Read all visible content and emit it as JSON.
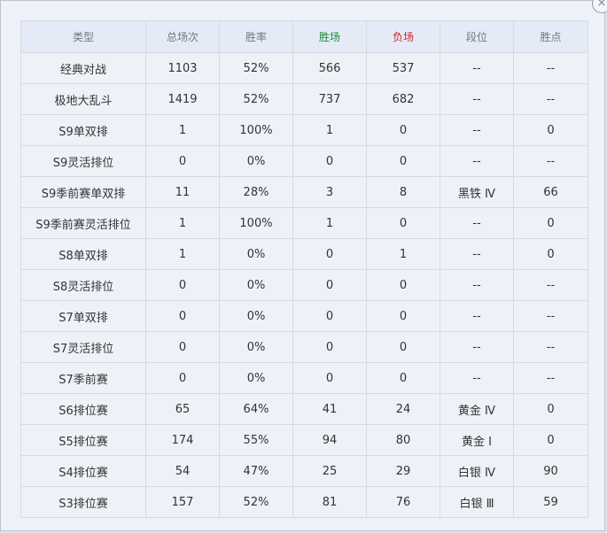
{
  "headers": {
    "type": "类型",
    "total": "总场次",
    "rate": "胜率",
    "wins": "胜场",
    "losses": "负场",
    "rank": "段位",
    "points": "胜点"
  },
  "colors": {
    "wins_header": "#1d8a3c",
    "losses_header": "#d32424"
  },
  "close_icon": "×",
  "rows": [
    {
      "type": "经典对战",
      "total": "1103",
      "rate": "52%",
      "wins": "566",
      "losses": "537",
      "rank": "--",
      "points": "--"
    },
    {
      "type": "极地大乱斗",
      "total": "1419",
      "rate": "52%",
      "wins": "737",
      "losses": "682",
      "rank": "--",
      "points": "--"
    },
    {
      "type": "S9单双排",
      "total": "1",
      "rate": "100%",
      "wins": "1",
      "losses": "0",
      "rank": "--",
      "points": "0"
    },
    {
      "type": "S9灵活排位",
      "total": "0",
      "rate": "0%",
      "wins": "0",
      "losses": "0",
      "rank": "--",
      "points": "--"
    },
    {
      "type": "S9季前赛单双排",
      "total": "11",
      "rate": "28%",
      "wins": "3",
      "losses": "8",
      "rank": "黑铁 Ⅳ",
      "points": "66"
    },
    {
      "type": "S9季前赛灵活排位",
      "total": "1",
      "rate": "100%",
      "wins": "1",
      "losses": "0",
      "rank": "--",
      "points": "0"
    },
    {
      "type": "S8单双排",
      "total": "1",
      "rate": "0%",
      "wins": "0",
      "losses": "1",
      "rank": "--",
      "points": "0"
    },
    {
      "type": "S8灵活排位",
      "total": "0",
      "rate": "0%",
      "wins": "0",
      "losses": "0",
      "rank": "--",
      "points": "--"
    },
    {
      "type": "S7单双排",
      "total": "0",
      "rate": "0%",
      "wins": "0",
      "losses": "0",
      "rank": "--",
      "points": "--"
    },
    {
      "type": "S7灵活排位",
      "total": "0",
      "rate": "0%",
      "wins": "0",
      "losses": "0",
      "rank": "--",
      "points": "--"
    },
    {
      "type": "S7季前赛",
      "total": "0",
      "rate": "0%",
      "wins": "0",
      "losses": "0",
      "rank": "--",
      "points": "--"
    },
    {
      "type": "S6排位赛",
      "total": "65",
      "rate": "64%",
      "wins": "41",
      "losses": "24",
      "rank": "黄金 Ⅳ",
      "points": "0"
    },
    {
      "type": "S5排位赛",
      "total": "174",
      "rate": "55%",
      "wins": "94",
      "losses": "80",
      "rank": "黄金 Ⅰ",
      "points": "0"
    },
    {
      "type": "S4排位赛",
      "total": "54",
      "rate": "47%",
      "wins": "25",
      "losses": "29",
      "rank": "白银 Ⅳ",
      "points": "90"
    },
    {
      "type": "S3排位赛",
      "total": "157",
      "rate": "52%",
      "wins": "81",
      "losses": "76",
      "rank": "白银 Ⅲ",
      "points": "59"
    }
  ]
}
